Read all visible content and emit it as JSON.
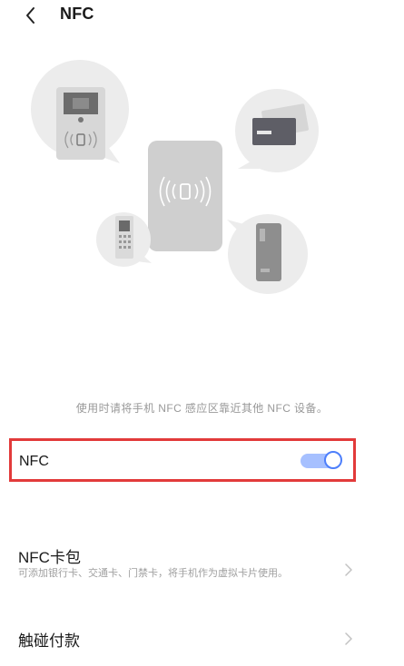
{
  "header": {
    "back_icon": "chevron-left-icon",
    "title": "NFC"
  },
  "illustration": {
    "description_icons": [
      "access-control-icon",
      "bank-card-icon",
      "phone-nfc-icon",
      "card-reader-icon",
      "transit-card-icon"
    ]
  },
  "hint": "使用时请将手机 NFC 感应区靠近其他 NFC 设备。",
  "nfc_toggle": {
    "label": "NFC",
    "enabled": true,
    "accent": "#4d7ffb",
    "highlight": "#e23a3a"
  },
  "wallet": {
    "title": "NFC卡包",
    "description": "可添加银行卡、交通卡、门禁卡，将手机作为虚拟卡片使用。",
    "chevron_icon": "chevron-right-icon"
  },
  "touch_pay": {
    "title": "触碰付款",
    "chevron_icon": "chevron-right-icon"
  }
}
